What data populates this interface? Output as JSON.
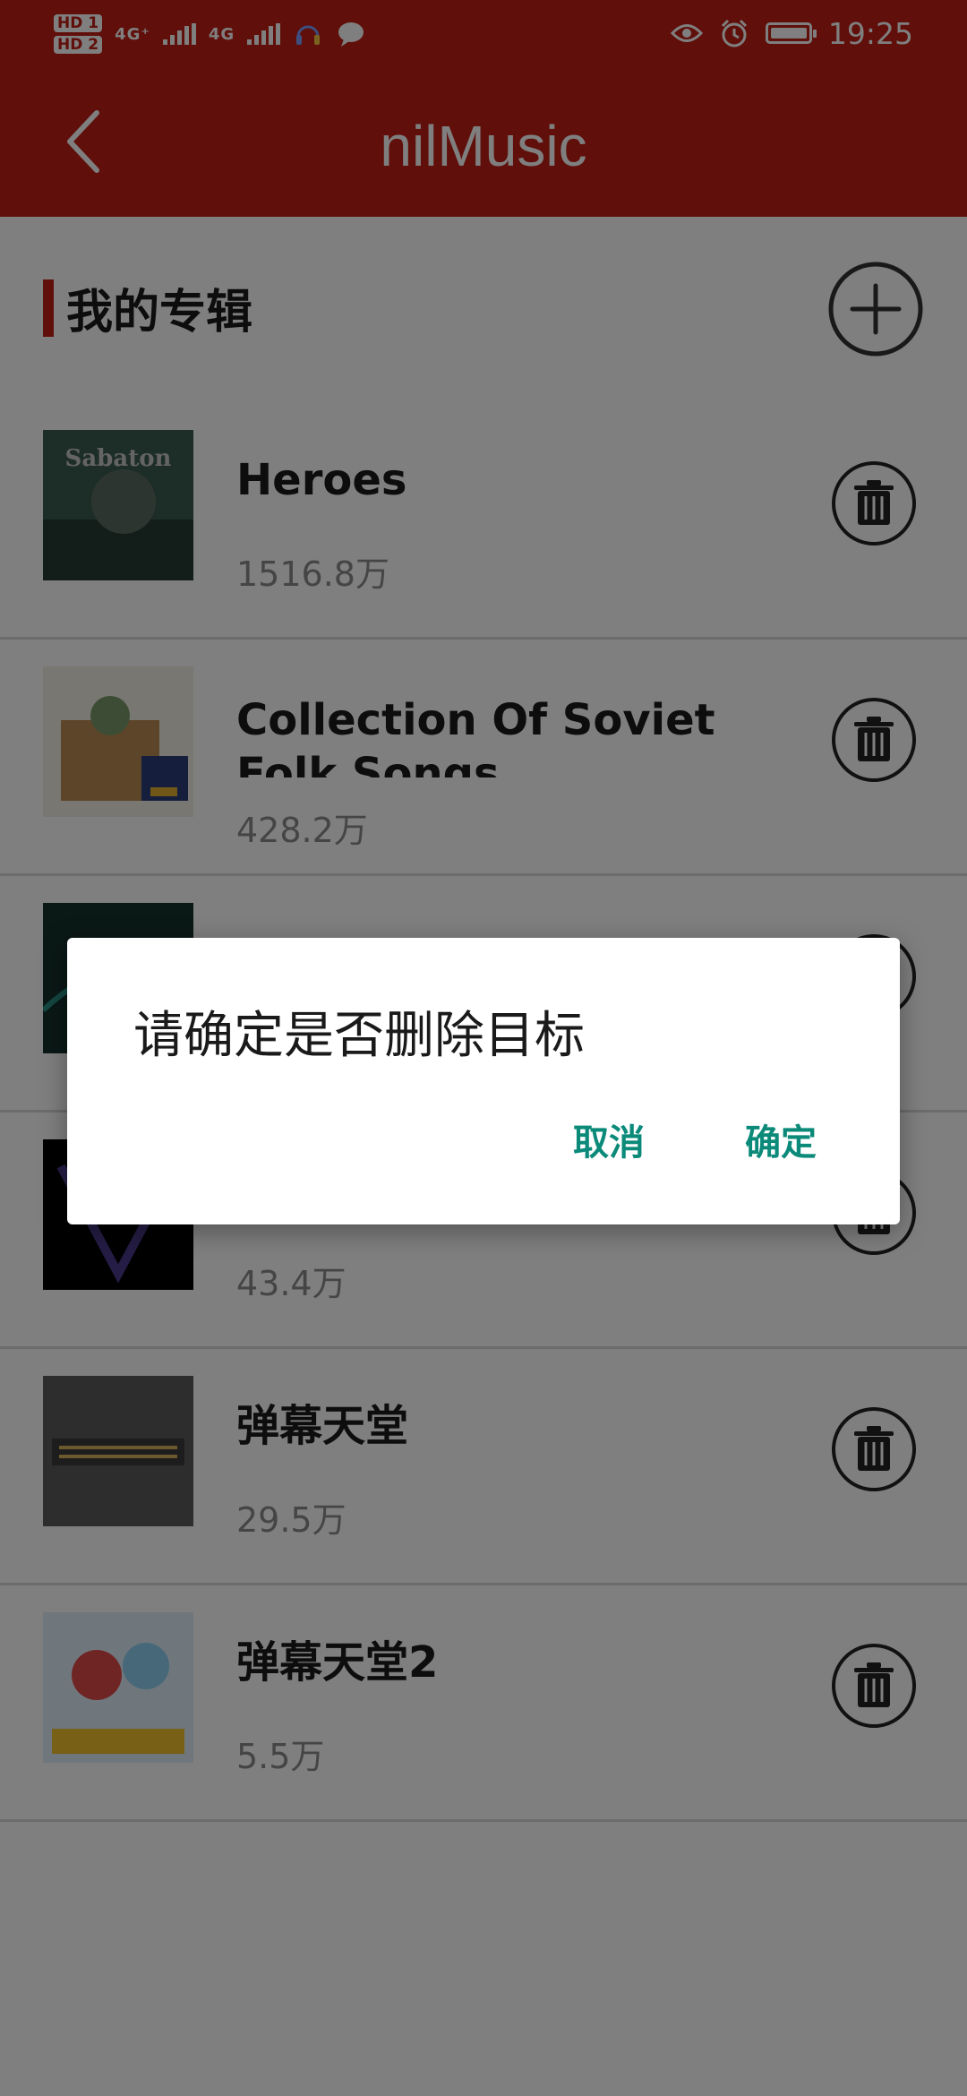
{
  "status_bar": {
    "hd1": "HD 1",
    "hd2": "HD 2",
    "signal1": "4G⁺",
    "signal2": "4G",
    "time": "19:25"
  },
  "app_bar": {
    "title": "nilMusic"
  },
  "section": {
    "title": "我的专辑"
  },
  "albums": [
    {
      "title": "Heroes",
      "count": "1516.8万"
    },
    {
      "title": "Collection Of Soviet Folk Songs",
      "count": "428.2万"
    },
    {
      "title": "",
      "count": ""
    },
    {
      "title": "",
      "count": "43.4万"
    },
    {
      "title": "弹幕天堂",
      "count": "29.5万"
    },
    {
      "title": "弹幕天堂2",
      "count": "5.5万"
    }
  ],
  "dialog": {
    "message": "请确定是否删除目标",
    "cancel_label": "取消",
    "confirm_label": "确定"
  },
  "colors": {
    "primary": "#c01e14",
    "dialog_button": "#0b8a7a",
    "overlay": "rgba(0,0,0,0.5)"
  }
}
